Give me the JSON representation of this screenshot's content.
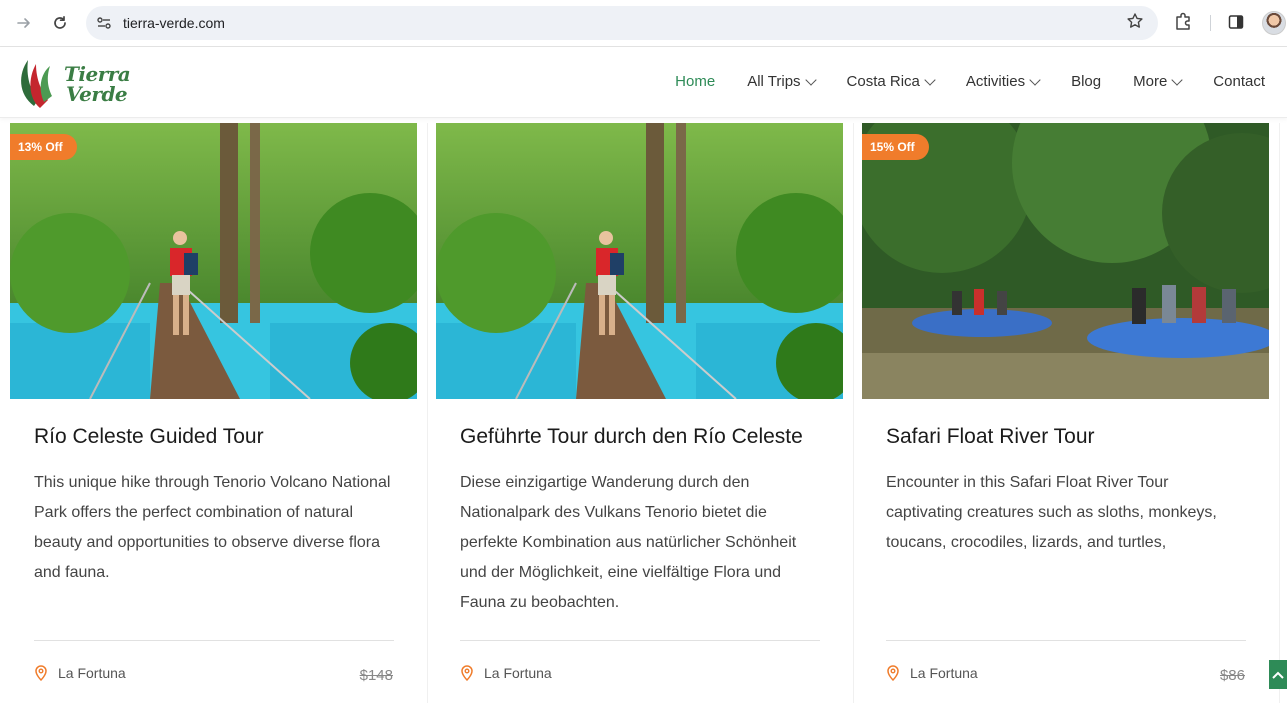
{
  "browser": {
    "url": "tierra-verde.com"
  },
  "site": {
    "logo_line1": "Tierra",
    "logo_line2": "Verde",
    "brand_color": "#2e8b57",
    "accent_color": "#f07c2b"
  },
  "menu": {
    "items": [
      {
        "label": "Home",
        "active": true,
        "dropdown": false
      },
      {
        "label": "All Trips",
        "active": false,
        "dropdown": true
      },
      {
        "label": "Costa Rica",
        "active": false,
        "dropdown": true
      },
      {
        "label": "Activities",
        "active": false,
        "dropdown": true
      },
      {
        "label": "Blog",
        "active": false,
        "dropdown": false
      },
      {
        "label": "More",
        "active": false,
        "dropdown": true
      },
      {
        "label": "Contact",
        "active": false,
        "dropdown": false
      }
    ]
  },
  "cards": [
    {
      "badge": "13% Off",
      "title": "Río Celeste Guided Tour",
      "description": "This unique hike through Tenorio Volcano National Park offers the perfect combination of natural beauty and opportunities to observe diverse flora and fauna.",
      "location": "La Fortuna",
      "old_price": "$148"
    },
    {
      "badge": "",
      "title": "Geführte Tour durch den Río Celeste",
      "description": "Diese einzigartige Wanderung durch den Nationalpark des Vulkans Tenorio bietet die perfekte Kombination aus natürlicher Schönheit und der Möglichkeit, eine vielfältige Flora und Fauna zu beobachten.",
      "location": "La Fortuna",
      "old_price": ""
    },
    {
      "badge": "15% Off",
      "title": "Safari Float River Tour",
      "description": "Encounter in this Safari Float River Tour captivating creatures such as sloths, monkeys, toucans, crocodiles, lizards, and turtles,",
      "location": "La Fortuna",
      "old_price": "$86"
    }
  ]
}
